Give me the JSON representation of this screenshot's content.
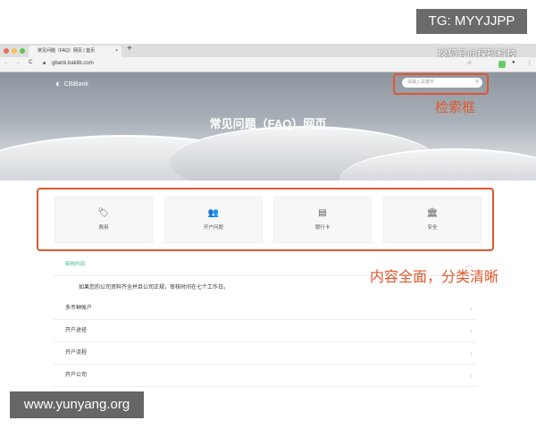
{
  "overlay": {
    "tg": "TG: MYYJJPP",
    "sohu": "搜狐号@探码科技",
    "search_annotation": "检索框",
    "content_annotation": "内容全面，分类清晰",
    "watermark": "www.yunyang.org"
  },
  "browser": {
    "tab_title": "常见问题（FAQ）网页 | 首页",
    "url": "gbank.baklib.com"
  },
  "header": {
    "logo": "CBiBank",
    "search_placeholder": "请输入关键字",
    "title": "常见问题（FAQ）网页"
  },
  "categories": [
    {
      "label": "费用",
      "icon": "tag-icon"
    },
    {
      "label": "开户问题",
      "icon": "users-icon"
    },
    {
      "label": "银行卡",
      "icon": "archive-icon"
    },
    {
      "label": "安全",
      "icon": "bank-icon"
    }
  ],
  "faq": {
    "expanded": {
      "title": "审核时间",
      "answer": "如果您的公司资料齐全并且公司正规，审核时间在七个工作日。"
    },
    "items": [
      "多币种账户",
      "开户途径",
      "开户流程",
      "开户公司"
    ]
  },
  "colors": {
    "accent": "#e0572d",
    "expanded_title": "#3cb39c"
  }
}
